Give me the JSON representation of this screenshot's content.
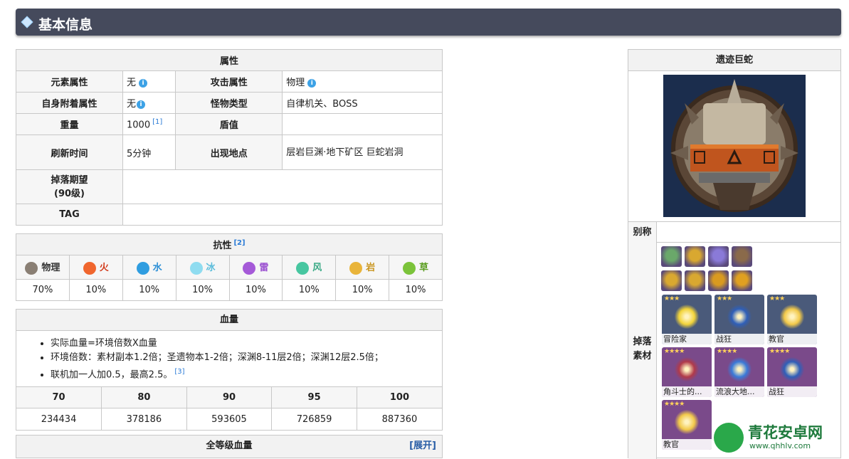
{
  "header": {
    "title": "基本信息"
  },
  "attributes": {
    "caption": "属性",
    "element_label": "元素属性",
    "element_value": "无",
    "attack_label": "攻击属性",
    "attack_value": "物理",
    "self_attach_label": "自身附着属性",
    "self_attach_value": "无",
    "monster_type_label": "怪物类型",
    "monster_type_value": "自律机关、BOSS",
    "weight_label": "重量",
    "weight_value": "1000",
    "weight_ref": "[1]",
    "shield_label": "盾值",
    "shield_value": "",
    "refresh_label": "刷新时间",
    "refresh_value": "5分钟",
    "location_label": "出现地点",
    "location_value": "层岩巨渊·地下矿区 巨蛇岩洞",
    "drop_expect_label_1": "掉落期望",
    "drop_expect_label_2": "(90级)",
    "drop_expect_value": "",
    "tag_label": "TAG",
    "tag_value": ""
  },
  "resistance": {
    "caption": "抗性",
    "caption_ref": "[2]",
    "items": [
      {
        "name": "物理",
        "value": "70%",
        "color": "#8a7f74",
        "text_color": "#333333"
      },
      {
        "name": "火",
        "value": "10%",
        "color": "#f0662e",
        "text_color": "#d23c1e"
      },
      {
        "name": "水",
        "value": "10%",
        "color": "#2f9de0",
        "text_color": "#2b8fd6"
      },
      {
        "name": "冰",
        "value": "10%",
        "color": "#8fdcf0",
        "text_color": "#5cbddb"
      },
      {
        "name": "雷",
        "value": "10%",
        "color": "#a55ad8",
        "text_color": "#9a4fd0"
      },
      {
        "name": "风",
        "value": "10%",
        "color": "#47c6a0",
        "text_color": "#3aaa86"
      },
      {
        "name": "岩",
        "value": "10%",
        "color": "#e9b43a",
        "text_color": "#c9951e"
      },
      {
        "name": "草",
        "value": "10%",
        "color": "#7bc33a",
        "text_color": "#5c9e22"
      }
    ]
  },
  "hp": {
    "caption": "血量",
    "notes": [
      "实际血量=环境倍数X血量",
      "环境倍数：素材副本1.2倍；圣遗物本1-2倍；深渊8-11层2倍；深渊12层2.5倍；",
      "联机加一人加0.5，最高2.5。"
    ],
    "note_ref": "[3]",
    "levels": [
      "70",
      "80",
      "90",
      "95",
      "100"
    ],
    "values": [
      "234434",
      "378186",
      "593605",
      "726859",
      "887360"
    ]
  },
  "all_hp": {
    "caption": "全等级血量",
    "expand": "[展开]"
  },
  "card": {
    "title": "遗迹巨蛇",
    "alias_label": "别称",
    "alias_value": "",
    "drop_label_1": "掉落",
    "drop_label_2": "素材",
    "materials": [
      {
        "icon": "sigil-icon",
        "color": "#6aa86a"
      },
      {
        "icon": "mora-icon",
        "color": "#d9a830"
      },
      {
        "icon": "eye-icon",
        "color": "#8a7ad8"
      },
      {
        "icon": "gear-icon",
        "color": "#8a6a4a"
      },
      {
        "icon": "gem-icon-1",
        "color": "#d9a830"
      },
      {
        "icon": "gem-icon-2",
        "color": "#d9a830"
      },
      {
        "icon": "gem-icon-3",
        "color": "#d99a20"
      },
      {
        "icon": "gem-icon-4",
        "color": "#e0a020"
      }
    ],
    "artifacts": [
      {
        "name": "冒险家",
        "stars": "★★★",
        "bg": "#4a5a7a",
        "flower": "#f2d43a"
      },
      {
        "name": "战狂",
        "stars": "★★★",
        "bg": "#4a5a7a",
        "flower": "#2f5fb8"
      },
      {
        "name": "教官",
        "stars": "★★★",
        "bg": "#4a5a7a",
        "flower": "#f2c94a"
      },
      {
        "name": "角斗士的...",
        "stars": "★★★★",
        "bg": "#7a4a8a",
        "flower": "#b03a4a"
      },
      {
        "name": "流浪大地...",
        "stars": "★★★★",
        "bg": "#7a4a8a",
        "flower": "#3a7ad8"
      },
      {
        "name": "战狂",
        "stars": "★★★★",
        "bg": "#7a4a8a",
        "flower": "#2f5fb8"
      },
      {
        "name": "教官",
        "stars": "★★★★",
        "bg": "#7a4a8a",
        "flower": "#f2c94a"
      }
    ]
  },
  "watermark": {
    "title": "青花安卓网",
    "url": "www.qhhlv.com"
  }
}
